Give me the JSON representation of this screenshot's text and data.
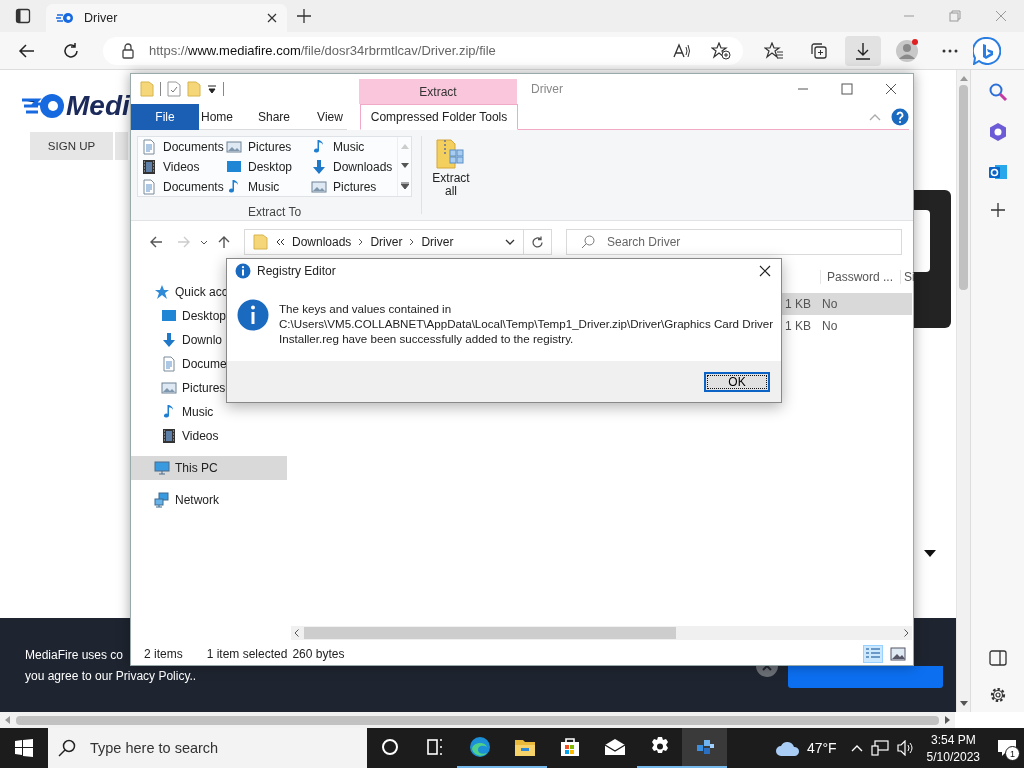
{
  "browser": {
    "tab": {
      "title": "Driver"
    },
    "address": {
      "scheme": "https://",
      "domain": "www.mediafire.com",
      "path": "/file/dosr34rbrmtlcav/Driver.zip/file"
    },
    "downloads_open": true
  },
  "webpage": {
    "logo_text": "Medi",
    "signup_button": "SIGN UP",
    "cookie_banner": {
      "lines": [
        "MediaFire uses co",
        "you agree to our Privacy Policy.."
      ]
    }
  },
  "explorer": {
    "title": "Driver",
    "context_group": "Extract",
    "tabs": [
      {
        "label": "File",
        "kind": "file",
        "selected": false
      },
      {
        "label": "Home",
        "kind": "plain",
        "selected": false
      },
      {
        "label": "Share",
        "kind": "plain",
        "selected": false
      },
      {
        "label": "View",
        "kind": "plain",
        "selected": false
      },
      {
        "label": "Compressed Folder Tools",
        "kind": "context",
        "selected": true
      }
    ],
    "extract_to": {
      "label": "Extract To",
      "destinations": [
        {
          "label": "Documents",
          "kind": "documents"
        },
        {
          "label": "Pictures",
          "kind": "pictures"
        },
        {
          "label": "Music",
          "kind": "music"
        },
        {
          "label": "Videos",
          "kind": "videos"
        },
        {
          "label": "Desktop",
          "kind": "desktop"
        },
        {
          "label": "Downloads",
          "kind": "downloads"
        },
        {
          "label": "Documents",
          "kind": "documents"
        },
        {
          "label": "Music",
          "kind": "music"
        },
        {
          "label": "Pictures",
          "kind": "pictures"
        }
      ]
    },
    "extract_all_button": "Extract all",
    "breadcrumb": [
      "Downloads",
      "Driver",
      "Driver"
    ],
    "search_placeholder": "Search Driver",
    "navigation": [
      {
        "label": "Quick acc",
        "kind": "quick_access",
        "selected": false,
        "children": [
          {
            "label": "Desktop",
            "kind": "desktop",
            "selected": false
          },
          {
            "label": "Downlo",
            "kind": "downloads",
            "selected": false
          },
          {
            "label": "Docume",
            "kind": "documents",
            "selected": false
          },
          {
            "label": "Pictures",
            "kind": "pictures",
            "selected": false
          },
          {
            "label": "Music",
            "kind": "music",
            "selected": false
          },
          {
            "label": "Videos",
            "kind": "videos",
            "selected": false
          }
        ]
      },
      {
        "label": "This PC",
        "kind": "pc",
        "selected": true
      },
      {
        "label": "Network",
        "kind": "network",
        "selected": false
      }
    ],
    "file_list": {
      "columns": [
        "",
        "Password ...",
        "Si"
      ],
      "rows": [
        {
          "cells": [
            "1 KB",
            "No"
          ],
          "selected": true
        },
        {
          "cells": [
            "1 KB",
            "No"
          ],
          "selected": false
        }
      ]
    },
    "status": {
      "items": "2 items",
      "selection": "1 item selected",
      "size": "260 bytes"
    },
    "views": [
      {
        "kind": "details",
        "selected": true
      },
      {
        "kind": "large_icons",
        "selected": false
      }
    ]
  },
  "dialog": {
    "title": "Registry Editor",
    "message": "The keys and values contained in C:\\Users\\VM5.COLLABNET\\AppData\\Local\\Temp\\Temp1_Driver.zip\\Driver\\Graphics Card Driver Installer.reg have been successfully added to the registry.",
    "button": "OK"
  },
  "taskbar": {
    "search_placeholder": "Type here to search",
    "apps": [
      {
        "kind": "cortana",
        "running": false,
        "active": false
      },
      {
        "kind": "task_view",
        "running": false,
        "active": false
      },
      {
        "kind": "edge",
        "running": true,
        "active": false
      },
      {
        "kind": "explorer",
        "running": true,
        "active": false
      },
      {
        "kind": "store",
        "running": false,
        "active": false
      },
      {
        "kind": "mail",
        "running": false,
        "active": false
      },
      {
        "kind": "settings",
        "running": true,
        "active": false
      },
      {
        "kind": "regedit",
        "running": true,
        "active": true
      }
    ],
    "weather": "47°F",
    "time": "3:54 PM",
    "date": "5/10/2023",
    "notifications": "1"
  }
}
